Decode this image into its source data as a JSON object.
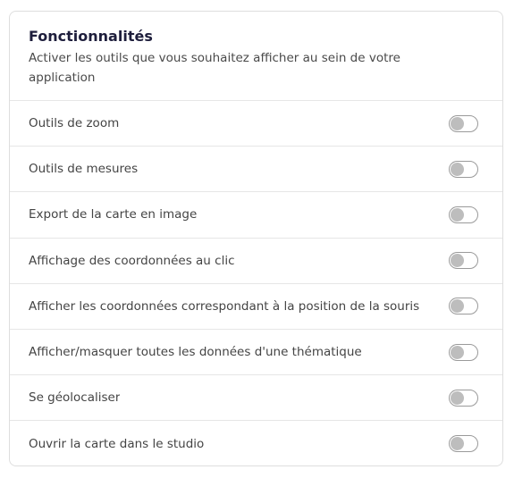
{
  "panel": {
    "title": "Fonctionnalités",
    "description": "Activer les outils que vous souhaitez afficher au sein de votre application"
  },
  "features": [
    {
      "label": "Outils de zoom",
      "enabled": false
    },
    {
      "label": "Outils de mesures",
      "enabled": false
    },
    {
      "label": "Export de la carte en image",
      "enabled": false
    },
    {
      "label": "Affichage des coordonnées au clic",
      "enabled": false
    },
    {
      "label": "Afficher les coordonnées correspondant à la position de la souris",
      "enabled": false
    },
    {
      "label": "Afficher/masquer toutes les données d'une thématique",
      "enabled": false
    },
    {
      "label": "Se géolocaliser",
      "enabled": false
    },
    {
      "label": "Ouvrir la carte dans le studio",
      "enabled": false
    }
  ],
  "colors": {
    "title": "#1e1e3c",
    "text": "#444444",
    "toggle_off_knob": "#bdbdbd",
    "toggle_border": "#9a9a9a",
    "divider": "#e6e6e6"
  }
}
